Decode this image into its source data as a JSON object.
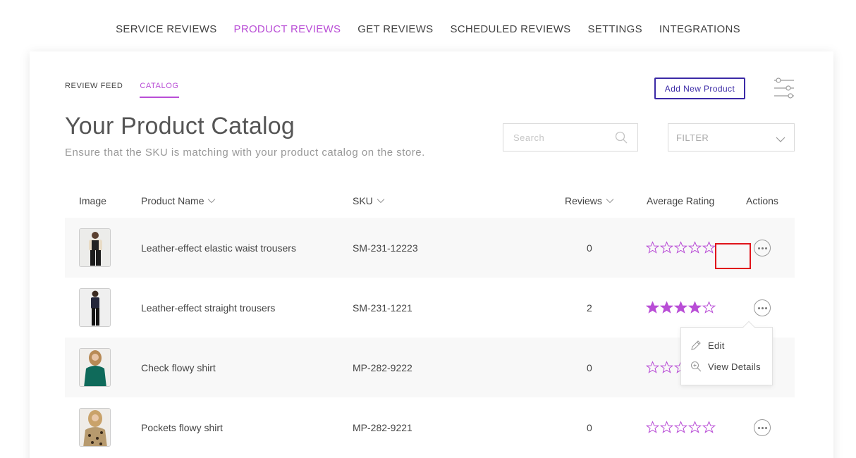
{
  "topnav": {
    "items": [
      {
        "label": "SERVICE REVIEWS",
        "active": false
      },
      {
        "label": "PRODUCT REVIEWS",
        "active": true
      },
      {
        "label": "GET REVIEWS",
        "active": false
      },
      {
        "label": "SCHEDULED REVIEWS",
        "active": false
      },
      {
        "label": "SETTINGS",
        "active": false
      },
      {
        "label": "INTEGRATIONS",
        "active": false
      }
    ]
  },
  "subtabs": [
    {
      "label": "REVIEW FEED",
      "active": false
    },
    {
      "label": "CATALOG",
      "active": true
    }
  ],
  "toolbar": {
    "add_label": "Add New Product",
    "settings_icon": "sliders-icon"
  },
  "page": {
    "title": "Your Product Catalog",
    "subtitle": "Ensure that the SKU is matching with your product catalog on the store."
  },
  "search": {
    "placeholder": "Search",
    "value": ""
  },
  "filter": {
    "label": "FILTER"
  },
  "table": {
    "headers": {
      "image": "Image",
      "product_name": "Product Name",
      "sku": "SKU",
      "reviews": "Reviews",
      "average_rating": "Average Rating",
      "actions": "Actions"
    },
    "rows": [
      {
        "name": "Leather-effect elastic waist trousers",
        "sku": "SM-231-12223",
        "reviews": "0",
        "rating": 0
      },
      {
        "name": "Leather-effect straight trousers",
        "sku": "SM-231-1221",
        "reviews": "2",
        "rating": 4
      },
      {
        "name": "Check flowy shirt",
        "sku": "MP-282-9222",
        "reviews": "0",
        "rating": 0
      },
      {
        "name": "Pockets flowy shirt",
        "sku": "MP-282-9221",
        "reviews": "0",
        "rating": 0
      }
    ]
  },
  "actions_menu": {
    "items": [
      {
        "label": "Edit",
        "icon": "pencil-icon"
      },
      {
        "label": "View Details",
        "icon": "zoom-icon"
      }
    ]
  },
  "colors": {
    "accent": "#b94ed6",
    "button_border": "#3b2aa6",
    "highlight": "#e0141b"
  }
}
